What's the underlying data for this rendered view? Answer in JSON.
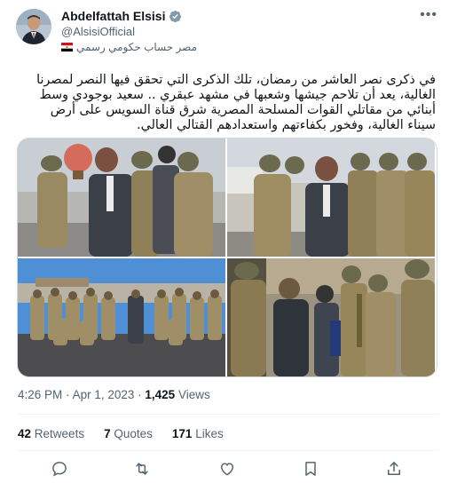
{
  "user": {
    "display_name": "Abdelfattah Elsisi",
    "handle": "@AlsisiOfficial",
    "account_label": "مصر حساب حكومي رسمي"
  },
  "tweet": {
    "text": "في ذكرى نصر العاشر من رمضان، تلك الذكرى التي تحقق فيها النصر لمصرنا الغالية، يعد أن تلاحم جيشها وشعبها في مشهد عبقري .. سعيد بوجودي وسط أبنائي من مقاتلي القوات المسلحة المصرية شرق قناة السويس على أرض سيناء الغالية، وفخور بكفاءتهم واستعدادهم القتالي العالي."
  },
  "meta": {
    "time": "4:26 PM",
    "separator": "·",
    "date": "Apr 1, 2023",
    "views_count": "1,425",
    "views_label": "Views"
  },
  "stats": {
    "retweets_count": "42",
    "retweets_label": "Retweets",
    "quotes_count": "7",
    "quotes_label": "Quotes",
    "likes_count": "171",
    "likes_label": "Likes"
  },
  "icons": {
    "verified": "verified-badge-icon",
    "more": "more-options-icon",
    "reply": "reply-icon",
    "retweet": "retweet-icon",
    "like": "like-icon",
    "bookmark": "bookmark-icon",
    "share": "share-icon"
  },
  "colors": {
    "text": "#0f1419",
    "secondary": "#536471",
    "verified": "#829aab",
    "border": "#cfd9de"
  }
}
